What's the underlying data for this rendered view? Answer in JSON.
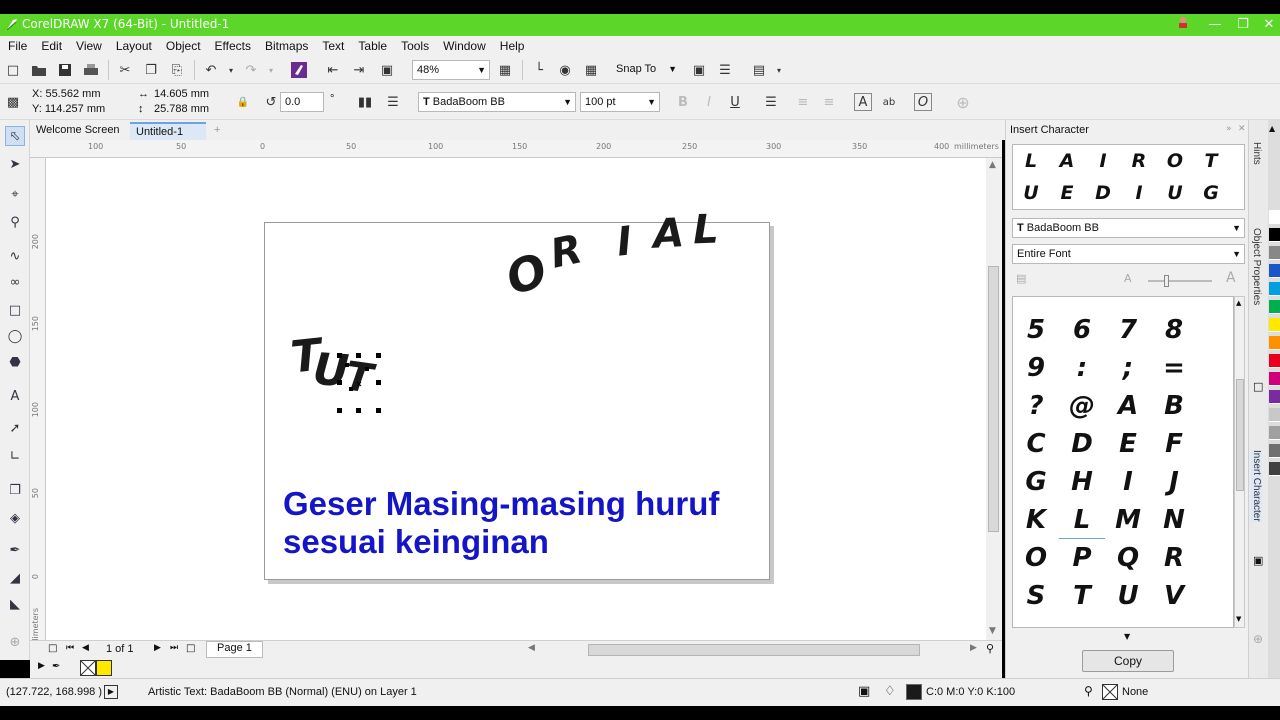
{
  "window": {
    "title": "CorelDRAW X7 (64-Bit) - Untitled-1"
  },
  "menu": [
    "File",
    "Edit",
    "View",
    "Layout",
    "Object",
    "Effects",
    "Bitmaps",
    "Text",
    "Table",
    "Tools",
    "Window",
    "Help"
  ],
  "standard_toolbar": {
    "zoom_level": "48%",
    "snap_to_label": "Snap To"
  },
  "property_bar": {
    "x": "X: 55.562 mm",
    "y": "Y: 114.257 mm",
    "width": "14.605 mm",
    "height": "25.788 mm",
    "rotation": "0.0",
    "degree_symbol": "°",
    "font_name": "BadaBoom BB",
    "font_size": "100 pt"
  },
  "doc_tabs": {
    "welcome": "Welcome Screen",
    "current": "Untitled-1"
  },
  "ruler": {
    "unit": "millimeters",
    "h_ticks": [
      "100",
      "50",
      "0",
      "50",
      "100",
      "150",
      "200",
      "250",
      "300",
      "350",
      "400"
    ],
    "v_ticks": [
      "200",
      "150",
      "100",
      "50",
      "0"
    ],
    "v_unit": "millimeters"
  },
  "canvas": {
    "arc_letters": [
      "O",
      "R",
      "I",
      "A",
      "L"
    ],
    "tut_letters": [
      "T",
      "U",
      "T"
    ],
    "caption_line1": "Geser Masing-masing huruf",
    "caption_line2": "sesuai keinginan",
    "caption_color": "#1515c8"
  },
  "page_nav": {
    "page_count": "1 of 1",
    "page_tab": "Page 1"
  },
  "status": {
    "cursor_position": "(127.722, 168.998 )",
    "object_info": "Artistic Text: BadaBoom BB (Normal) (ENU) on Layer 1",
    "fill_value": "C:0 M:0 Y:0 K:100",
    "outline_value": "None"
  },
  "docker": {
    "title": "Insert Character",
    "recent_row1": [
      "L",
      "A",
      "I",
      "R",
      "O",
      "T"
    ],
    "recent_row2": [
      "U",
      "E",
      "D",
      "I",
      "U",
      "G"
    ],
    "font_select": "BadaBoom BB",
    "filter_select": "Entire Font",
    "grid": [
      [
        "5",
        "6",
        "7",
        "8"
      ],
      [
        "9",
        ":",
        ";",
        "="
      ],
      [
        "?",
        "@",
        "A",
        "B"
      ],
      [
        "C",
        "D",
        "E",
        "F"
      ],
      [
        "G",
        "H",
        "I",
        "J"
      ],
      [
        "K",
        "L",
        "M",
        "N"
      ],
      [
        "O",
        "P",
        "Q",
        "R"
      ],
      [
        "S",
        "T",
        "U",
        "V"
      ]
    ],
    "copy_button": "Copy"
  },
  "side_tabs": [
    "Hints",
    "Object Properties",
    "Insert Character"
  ],
  "palette": [
    "#ffffff",
    "#000000",
    "#888888",
    "#1a56c8",
    "#00a0e0",
    "#00b050",
    "#ffe800",
    "#ff9000",
    "#e8001c",
    "#d0007a",
    "#7a2c9e",
    "#c8c8c8",
    "#a0a0a0",
    "#707070",
    "#404040"
  ],
  "colors": {
    "titlebar": "#5dd62a",
    "active_tab": "#dde8f6"
  }
}
